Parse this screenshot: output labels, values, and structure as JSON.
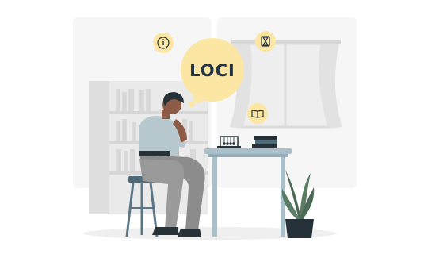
{
  "illustration": {
    "thought_bubble_text": "LOCI",
    "colors": {
      "background": "#ffffff",
      "wall_panel": "#f4f4f4",
      "shelf_grey": "#e3e3e3",
      "bubble_yellow": "#fbe7a3",
      "bubble_ring": "#f6d97a",
      "icon_dark": "#263238",
      "desk_grey": "#a9bfca",
      "trousers": "#8c8c8c",
      "shirt": "#b7c9cf",
      "plant_green": "#4b6b55"
    },
    "icons": [
      "info-icon",
      "hourglass-icon",
      "book-icon"
    ]
  }
}
